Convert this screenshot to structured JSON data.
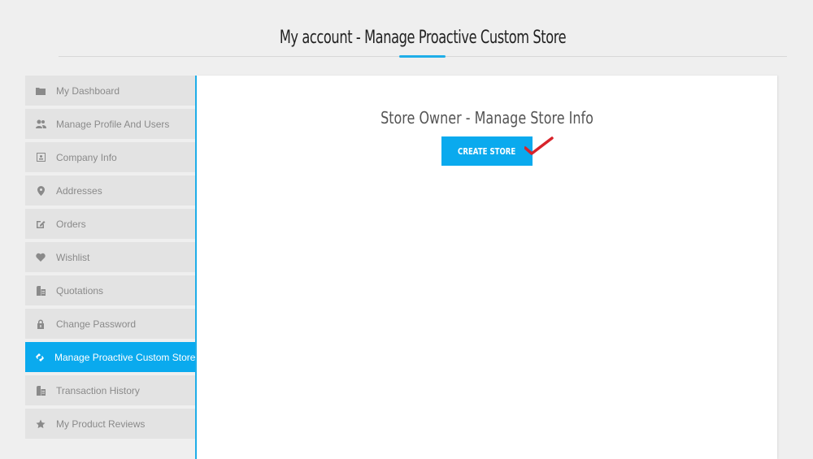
{
  "header": {
    "title": "My account - Manage Proactive Custom Store"
  },
  "sidebar": {
    "items": [
      {
        "label": "My Dashboard",
        "icon": "folder-icon",
        "active": false
      },
      {
        "label": "Manage Profile And Users",
        "icon": "users-icon",
        "active": false
      },
      {
        "label": "Company Info",
        "icon": "contact-card-icon",
        "active": false
      },
      {
        "label": "Addresses",
        "icon": "map-marker-icon",
        "active": false
      },
      {
        "label": "Orders",
        "icon": "edit-icon",
        "active": false
      },
      {
        "label": "Wishlist",
        "icon": "heart-icon",
        "active": false
      },
      {
        "label": "Quotations",
        "icon": "documents-icon",
        "active": false
      },
      {
        "label": "Change Password",
        "icon": "lock-icon",
        "active": false
      },
      {
        "label": "Manage Proactive Custom Store",
        "icon": "store-link-icon",
        "active": true
      },
      {
        "label": "Transaction History",
        "icon": "documents-icon",
        "active": false
      },
      {
        "label": "My Product Reviews",
        "icon": "star-icon",
        "active": false
      }
    ]
  },
  "main": {
    "section_title": "Store Owner - Manage Store Info",
    "create_store_label": "CREATE STORE",
    "annotation": "checkmark-annotation"
  },
  "colors": {
    "accent": "#0aaaee",
    "sidebar_bg": "#e3e3e3",
    "annotation": "#d8232a"
  }
}
